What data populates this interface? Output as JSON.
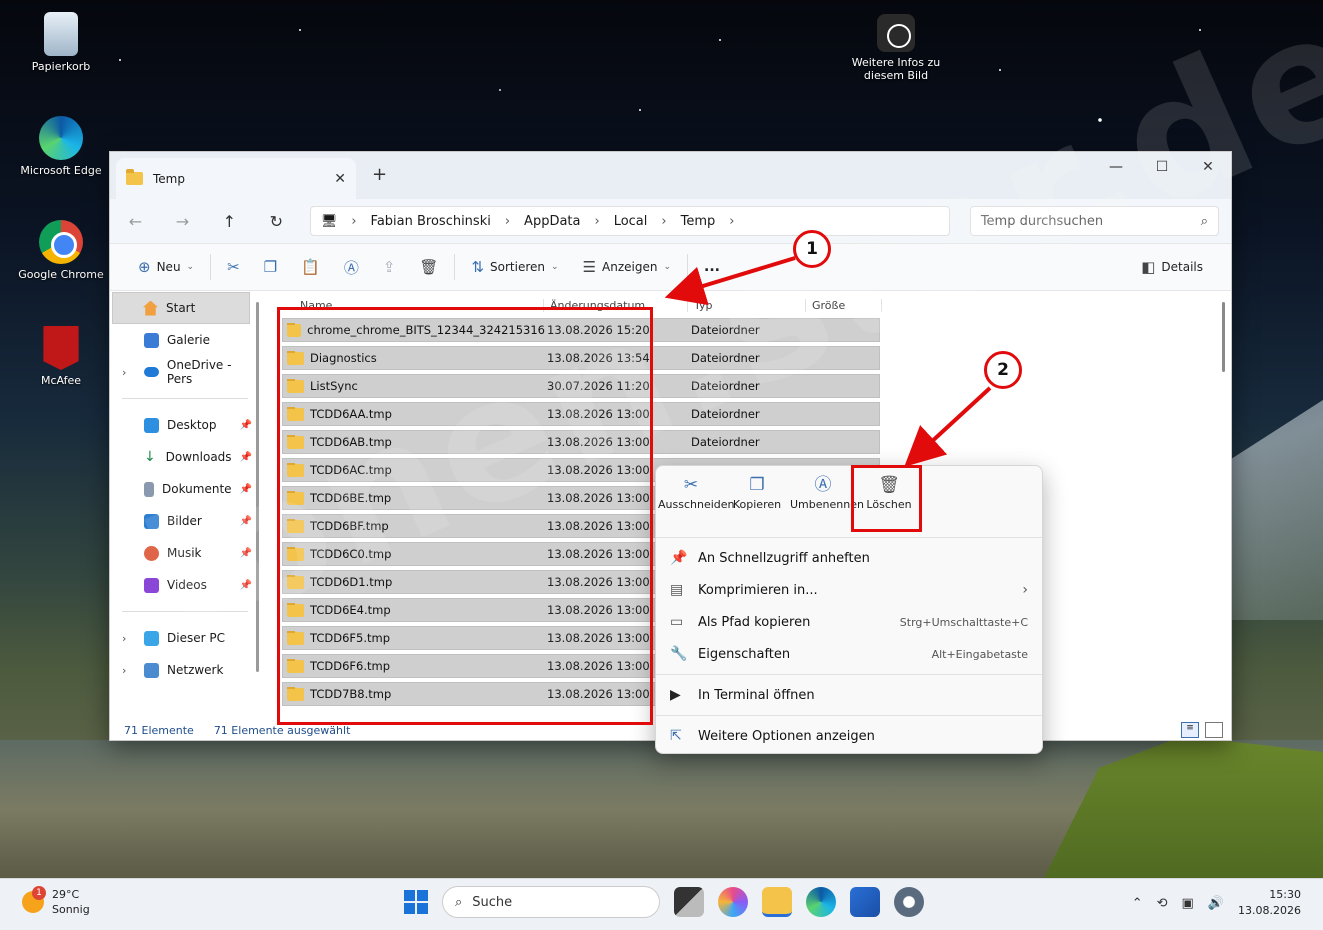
{
  "desktop": {
    "icons": [
      {
        "label": "Papierkorb"
      },
      {
        "label": "Microsoft Edge"
      },
      {
        "label": "Google Chrome"
      },
      {
        "label": "McAfee"
      }
    ],
    "info_label": "Weitere Infos zu diesem Bild",
    "watermark": "ionen.star.de"
  },
  "window": {
    "tab_title": "Temp",
    "breadcrumb": [
      "Fabian Broschinski",
      "AppData",
      "Local",
      "Temp"
    ],
    "search_placeholder": "Temp durchsuchen",
    "toolbar": {
      "new_label": "Neu",
      "sort_label": "Sortieren",
      "view_label": "Anzeigen",
      "more_label": "...",
      "details_label": "Details"
    },
    "sidebar": {
      "top": [
        {
          "label": "Start"
        },
        {
          "label": "Galerie"
        },
        {
          "label": "OneDrive - Pers"
        }
      ],
      "quick": [
        {
          "label": "Desktop"
        },
        {
          "label": "Downloads"
        },
        {
          "label": "Dokumente"
        },
        {
          "label": "Bilder"
        },
        {
          "label": "Musik"
        },
        {
          "label": "Videos"
        }
      ],
      "bottom": [
        {
          "label": "Dieser PC"
        },
        {
          "label": "Netzwerk"
        }
      ]
    },
    "columns": {
      "name": "Name",
      "date": "Änderungsdatum",
      "type": "Typ",
      "size": "Größe"
    },
    "files": [
      {
        "name": "chrome_chrome_BITS_12344_324215316",
        "date": "13.08.2026 15:20",
        "type": "Dateiordner"
      },
      {
        "name": "Diagnostics",
        "date": "13.08.2026 13:54",
        "type": "Dateiordner"
      },
      {
        "name": "ListSync",
        "date": "30.07.2026 11:20",
        "type": "Dateiordner"
      },
      {
        "name": "TCDD6AA.tmp",
        "date": "13.08.2026 13:00",
        "type": "Dateiordner"
      },
      {
        "name": "TCDD6AB.tmp",
        "date": "13.08.2026 13:00",
        "type": "Dateiordner"
      },
      {
        "name": "TCDD6AC.tmp",
        "date": "13.08.2026 13:00",
        "type": ""
      },
      {
        "name": "TCDD6BE.tmp",
        "date": "13.08.2026 13:00",
        "type": ""
      },
      {
        "name": "TCDD6BF.tmp",
        "date": "13.08.2026 13:00",
        "type": ""
      },
      {
        "name": "TCDD6C0.tmp",
        "date": "13.08.2026 13:00",
        "type": ""
      },
      {
        "name": "TCDD6D1.tmp",
        "date": "13.08.2026 13:00",
        "type": ""
      },
      {
        "name": "TCDD6E4.tmp",
        "date": "13.08.2026 13:00",
        "type": ""
      },
      {
        "name": "TCDD6F5.tmp",
        "date": "13.08.2026 13:00",
        "type": ""
      },
      {
        "name": "TCDD6F6.tmp",
        "date": "13.08.2026 13:00",
        "type": ""
      },
      {
        "name": "TCDD7B8.tmp",
        "date": "13.08.2026 13:00",
        "type": ""
      }
    ],
    "status": {
      "count": "71 Elemente",
      "selected": "71 Elemente ausgewählt"
    }
  },
  "context_menu": {
    "top": [
      {
        "label": "Ausschneiden"
      },
      {
        "label": "Kopieren"
      },
      {
        "label": "Umbenennen"
      },
      {
        "label": "Löschen"
      }
    ],
    "items": [
      {
        "label": "An Schnellzugriff anheften",
        "shortcut": ""
      },
      {
        "label": "Komprimieren in...",
        "shortcut": ""
      },
      {
        "label": "Als Pfad kopieren",
        "shortcut": "Strg+Umschalttaste+C"
      },
      {
        "label": "Eigenschaften",
        "shortcut": "Alt+Eingabetaste"
      },
      {
        "label": "In Terminal öffnen",
        "shortcut": ""
      },
      {
        "label": "Weitere Optionen anzeigen",
        "shortcut": ""
      }
    ]
  },
  "annotations": {
    "badge1": "1",
    "badge2": "2",
    "color": "#e20b0b"
  },
  "taskbar": {
    "temperature": "29°C",
    "weather_text": "Sonnig",
    "weather_badge": "1",
    "search_label": "Suche",
    "time": "15:30",
    "date": "13.08.2026"
  }
}
